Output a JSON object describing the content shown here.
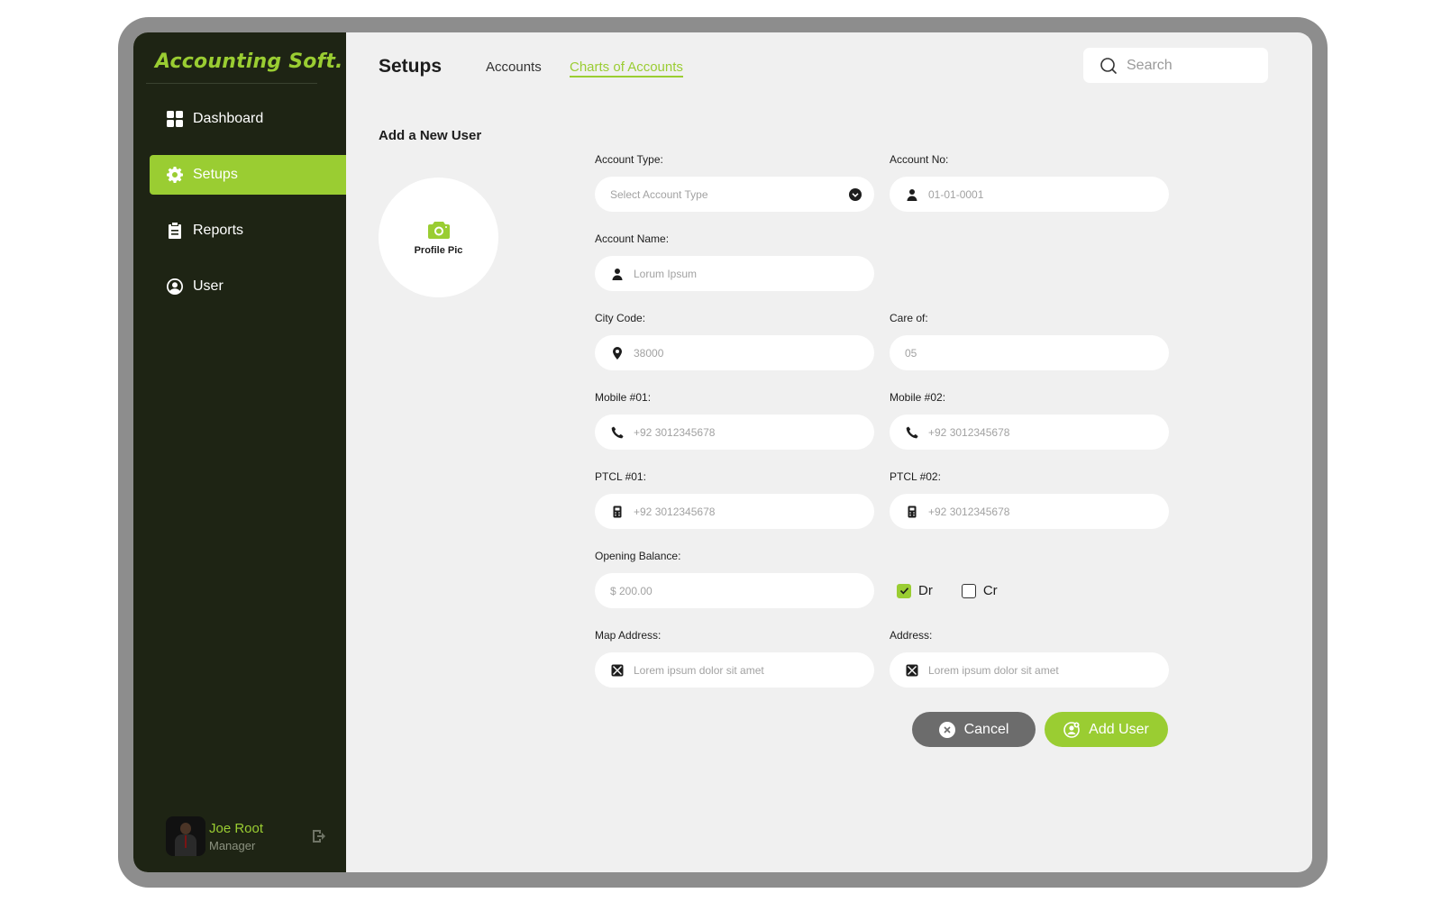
{
  "app": {
    "brand": "Accounting Soft."
  },
  "sidebar": {
    "items": [
      {
        "label": "Dashboard",
        "icon": "grid-icon"
      },
      {
        "label": "Setups",
        "icon": "gear-icon",
        "active": true
      },
      {
        "label": "Reports",
        "icon": "clipboard-icon"
      },
      {
        "label": "User",
        "icon": "user-circle-icon"
      }
    ],
    "profile": {
      "name": "Joe Root",
      "role": "Manager"
    }
  },
  "header": {
    "title": "Setups",
    "tabs": [
      {
        "label": "Accounts"
      },
      {
        "label": "Charts of Accounts",
        "active": true
      }
    ],
    "search_placeholder": "Search"
  },
  "form": {
    "section_title": "Add a New User",
    "profile_pic_label": "Profile Pic",
    "fields": {
      "account_type": {
        "label": "Account Type:",
        "placeholder": "Select Account Type"
      },
      "account_no": {
        "label": "Account No:",
        "placeholder": "01-01-0001"
      },
      "account_name": {
        "label": "Account Name:",
        "placeholder": "Lorum Ipsum"
      },
      "city_code": {
        "label": "City Code:",
        "placeholder": "38000"
      },
      "care_of": {
        "label": "Care of:",
        "placeholder": "05"
      },
      "mobile1": {
        "label": "Mobile #01:",
        "placeholder": "+92 3012345678"
      },
      "mobile2": {
        "label": "Mobile #02:",
        "placeholder": "+92 3012345678"
      },
      "ptcl1": {
        "label": "PTCL #01:",
        "placeholder": "+92 3012345678"
      },
      "ptcl2": {
        "label": "PTCL #02:",
        "placeholder": "+92 3012345678"
      },
      "opening_balance": {
        "label": "Opening Balance:",
        "placeholder": "$ 200.00"
      },
      "map_address": {
        "label": "Map Address:",
        "placeholder": "Lorem ipsum dolor sit amet"
      },
      "address": {
        "label": "Address:",
        "placeholder": "Lorem ipsum dolor sit amet"
      }
    },
    "balance_type": {
      "dr": {
        "label": "Dr",
        "checked": true
      },
      "cr": {
        "label": "Cr",
        "checked": false
      }
    },
    "buttons": {
      "cancel": "Cancel",
      "add": "Add User"
    }
  },
  "colors": {
    "accent": "#9acd32",
    "sidebar_bg": "#1e2414",
    "content_bg": "#f0f0f0",
    "cancel_bg": "#6c6c6c"
  }
}
